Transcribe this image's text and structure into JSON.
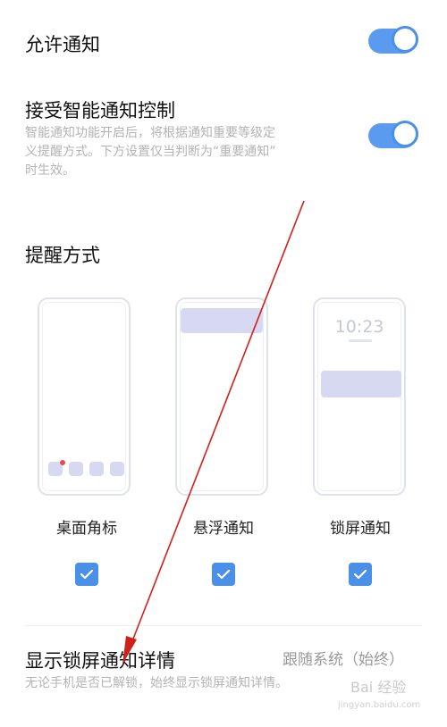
{
  "allow_notifications": {
    "title": "允许通知",
    "enabled": true
  },
  "smart_control": {
    "title": "接受智能通知控制",
    "desc_line1": "智能通知功能开启后，将根据通知重要等级定",
    "desc_line2": "义提醒方式。下方设置仅当判断为“重要通知”",
    "desc_line3": "时生效。",
    "enabled": true
  },
  "reminder": {
    "section_title": "提醒方式",
    "options": [
      {
        "label": "桌面角标",
        "checked": true
      },
      {
        "label": "悬浮通知",
        "checked": true
      },
      {
        "label": "锁屏通知",
        "checked": true
      }
    ],
    "lock_time": "10:23"
  },
  "lock_details": {
    "title": "显示锁屏通知详情",
    "value": "跟随系统（始终）",
    "desc": "无论手机是否已解锁，始终显示锁屏通知详情。"
  },
  "watermark": {
    "text": "Bai 经验",
    "sub": "jingyan.baidu.com"
  },
  "colors": {
    "accent": "#4a90e8",
    "annotation": "#d0201a"
  }
}
